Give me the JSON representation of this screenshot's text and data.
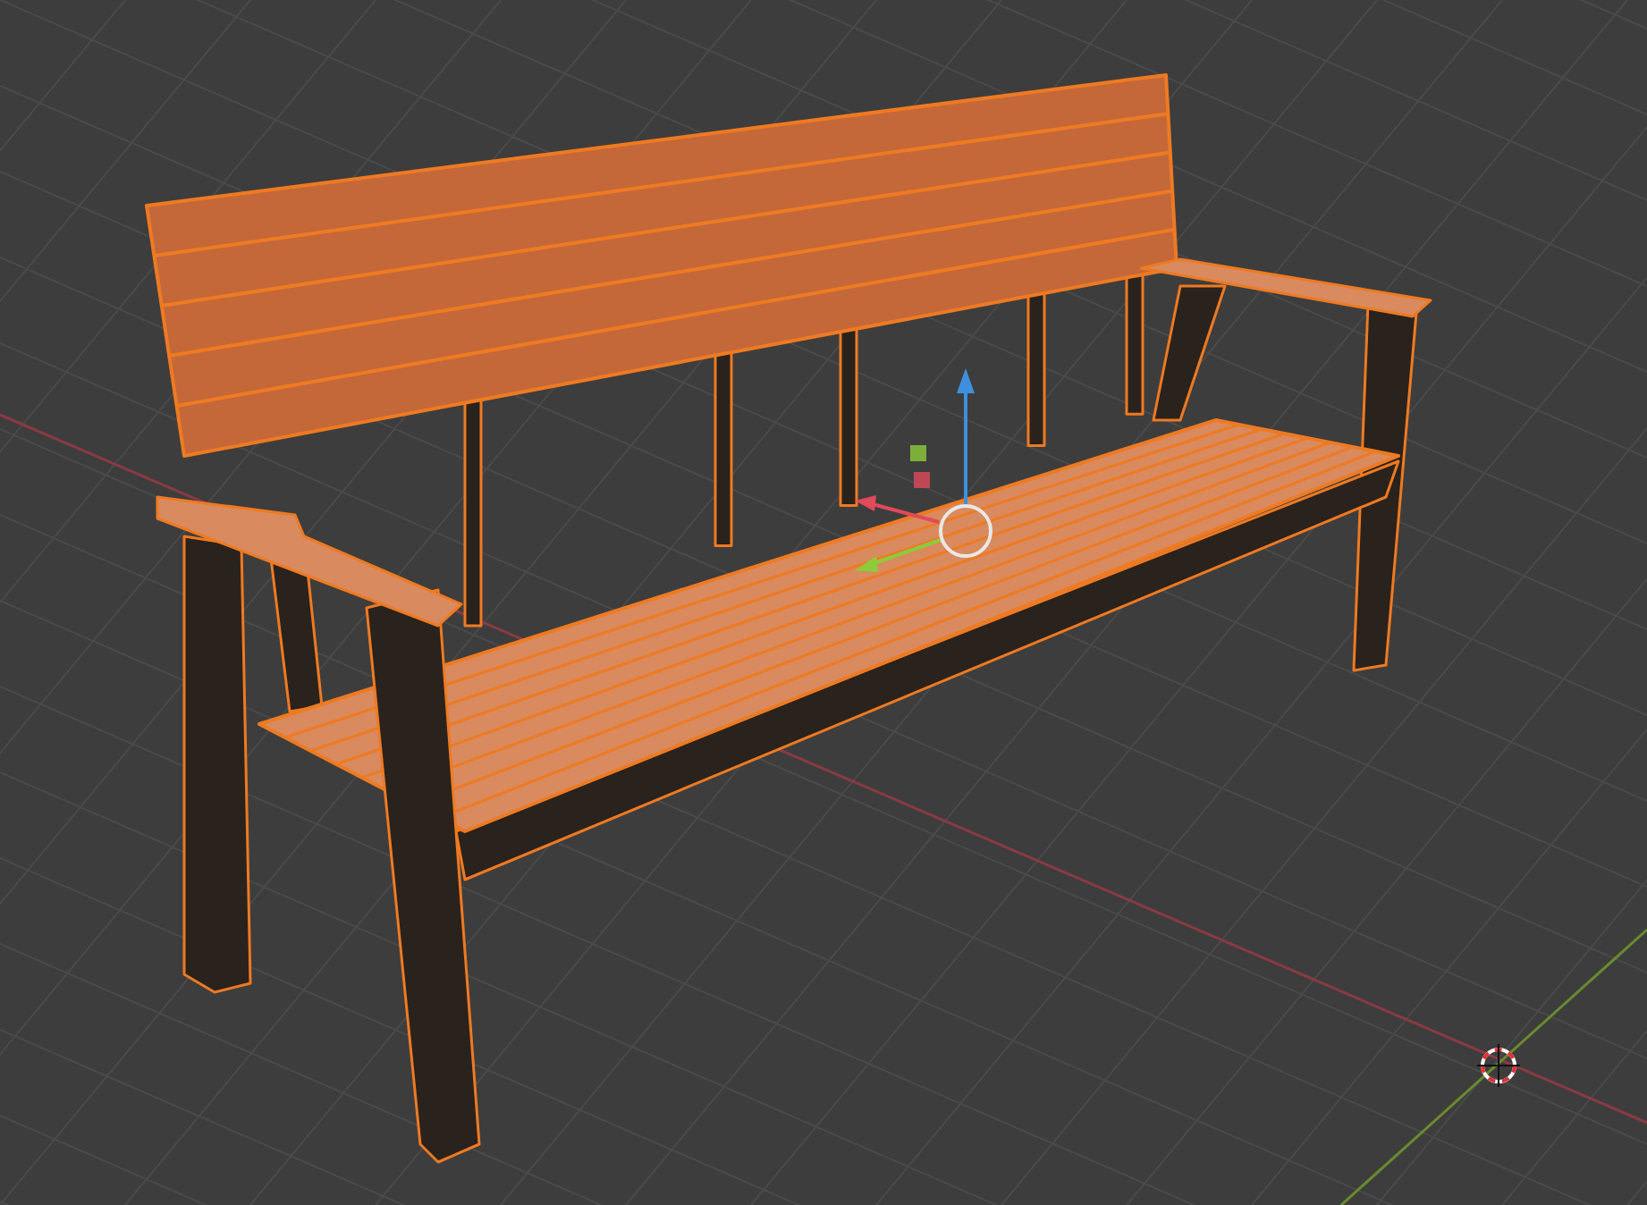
{
  "viewport": {
    "show_grid": true,
    "object_selected": true
  }
}
